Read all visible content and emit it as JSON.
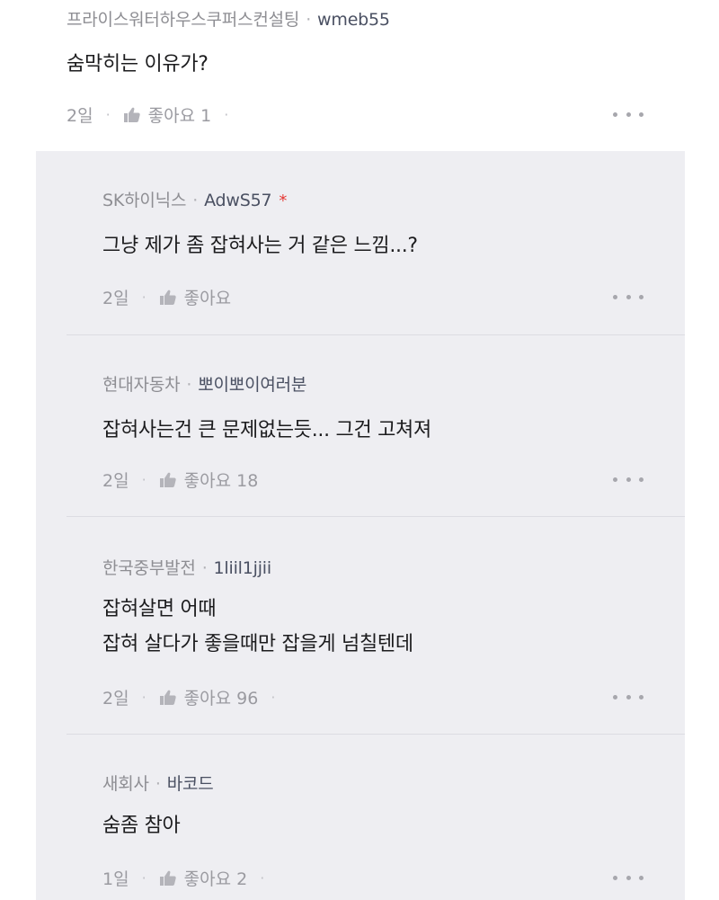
{
  "comment": {
    "company": "프라이스워터하우스쿠퍼스컨설팅",
    "separator": "·",
    "nickname": "wmeb55",
    "text": "숨막히는 이유가?",
    "time": "2일",
    "like_label": "좋아요 1"
  },
  "replies": [
    {
      "company": "SK하이닉스",
      "separator": "·",
      "nickname": "AdwS57",
      "author_mark": "*",
      "lines": [
        "그냥 제가 좀 잡혀사는 거 같은 느낌...?"
      ],
      "time": "2일",
      "like_label": "좋아요"
    },
    {
      "company": "현대자동차",
      "separator": "·",
      "nickname": "뽀이뽀이여러분",
      "lines": [
        "잡혀사는건 큰 문제없는듯... 그건 고쳐져"
      ],
      "time": "2일",
      "like_label": "좋아요 18"
    },
    {
      "company": "한국중부발전",
      "separator": "·",
      "nickname": "1liil1jjii",
      "lines": [
        "잡혀살면 어때",
        "잡혀 살다가 좋을때만 잡을게 넘칠텐데"
      ],
      "time": "2일",
      "like_label": "좋아요 96"
    },
    {
      "company": "새회사",
      "separator": "·",
      "nickname": "바코드",
      "lines": [
        "숨좀 참아"
      ],
      "time": "1일",
      "like_label": "좋아요 2"
    }
  ],
  "icons": {
    "like": "thumbs-up-icon",
    "more": "more-dots-icon"
  },
  "colors": {
    "reply_background": "#eeeef2",
    "nickname": "#4a5062",
    "author_mark": "#e53935",
    "meta_gray": "#8e8e93"
  }
}
